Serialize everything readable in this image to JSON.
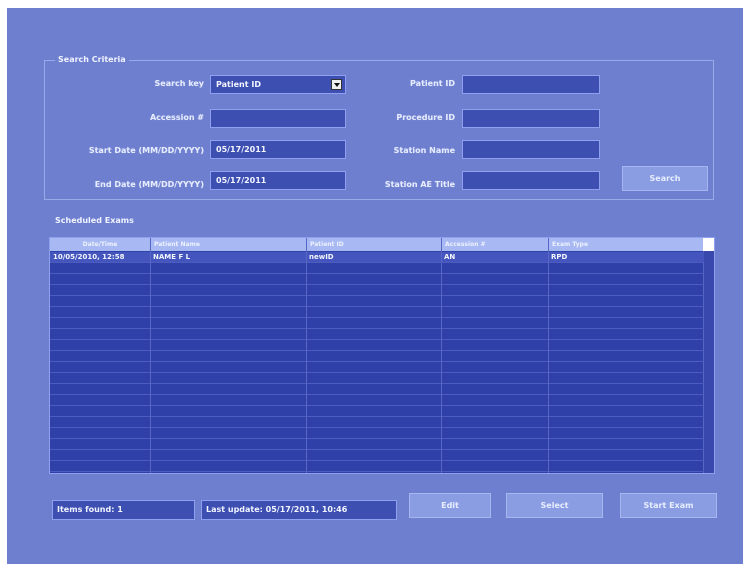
{
  "search_criteria": {
    "title": "Search Criteria",
    "search_key_label": "Search key",
    "search_key_value": "Patient ID",
    "accession_label": "Accession #",
    "accession_value": "",
    "start_date_label": "Start Date (MM/DD/YYYY)",
    "start_date_value": "05/17/2011",
    "end_date_label": "End Date (MM/DD/YYYY)",
    "end_date_value": "05/17/2011",
    "patient_id_label": "Patient ID",
    "patient_id_value": "",
    "procedure_id_label": "Procedure ID",
    "procedure_id_value": "",
    "station_name_label": "Station Name",
    "station_name_value": "",
    "station_ae_label": "Station AE Title",
    "station_ae_value": "",
    "search_button": "Search"
  },
  "scheduled_exams": {
    "title": "Scheduled Exams",
    "columns": [
      "Date/Time",
      "Patient Name",
      "Patient ID",
      "Accession #",
      "Exam Type"
    ],
    "rows": [
      [
        "10/05/2010, 12:58",
        "NAME F L",
        "newID",
        "AN",
        "RPD"
      ]
    ]
  },
  "footer": {
    "items_found": "Items found: 1",
    "last_update": "Last update: 05/17/2011, 10:46",
    "edit_button": "Edit",
    "select_button": "Select",
    "start_exam_button": "Start Exam"
  },
  "colors": {
    "background": "#6e7fcf",
    "field": "#3e4fb2",
    "table": "#2f41a8",
    "header": "#a8b8f2",
    "button": "#8a9de3"
  }
}
